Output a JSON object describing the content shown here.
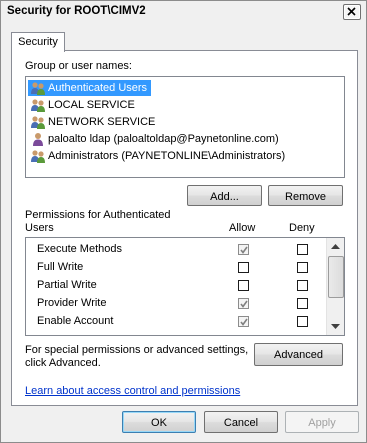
{
  "window": {
    "title": "Security for ROOT\\CIMV2"
  },
  "tabs": [
    {
      "label": "Security"
    }
  ],
  "groups": {
    "label": "Group or user names:",
    "items": [
      {
        "name": "Authenticated Users",
        "icon": "users-group-icon",
        "selected": true
      },
      {
        "name": "LOCAL SERVICE",
        "icon": "users-group-icon",
        "selected": false
      },
      {
        "name": "NETWORK SERVICE",
        "icon": "users-group-icon",
        "selected": false
      },
      {
        "name": "paloalto ldap (paloaltoldap@Paynetonline.com)",
        "icon": "single-user-icon",
        "selected": false
      },
      {
        "name": "Administrators (PAYNETONLINE\\Administrators)",
        "icon": "users-group-icon",
        "selected": false
      }
    ]
  },
  "buttons": {
    "add": "Add...",
    "remove": "Remove",
    "advanced": "Advanced",
    "ok": "OK",
    "cancel": "Cancel",
    "apply": "Apply"
  },
  "permissions": {
    "label_line1": "Permissions for Authenticated",
    "label_line2": "Users",
    "allow_header": "Allow",
    "deny_header": "Deny",
    "rows": [
      {
        "name": "Execute Methods",
        "allow": true,
        "deny": false
      },
      {
        "name": "Full Write",
        "allow": false,
        "deny": false
      },
      {
        "name": "Partial Write",
        "allow": false,
        "deny": false
      },
      {
        "name": "Provider Write",
        "allow": true,
        "deny": false
      },
      {
        "name": "Enable Account",
        "allow": true,
        "deny": false
      }
    ]
  },
  "advanced_text": {
    "line1": "For special permissions or advanced settings,",
    "line2": "click Advanced."
  },
  "help_link": "Learn about access control and permissions"
}
